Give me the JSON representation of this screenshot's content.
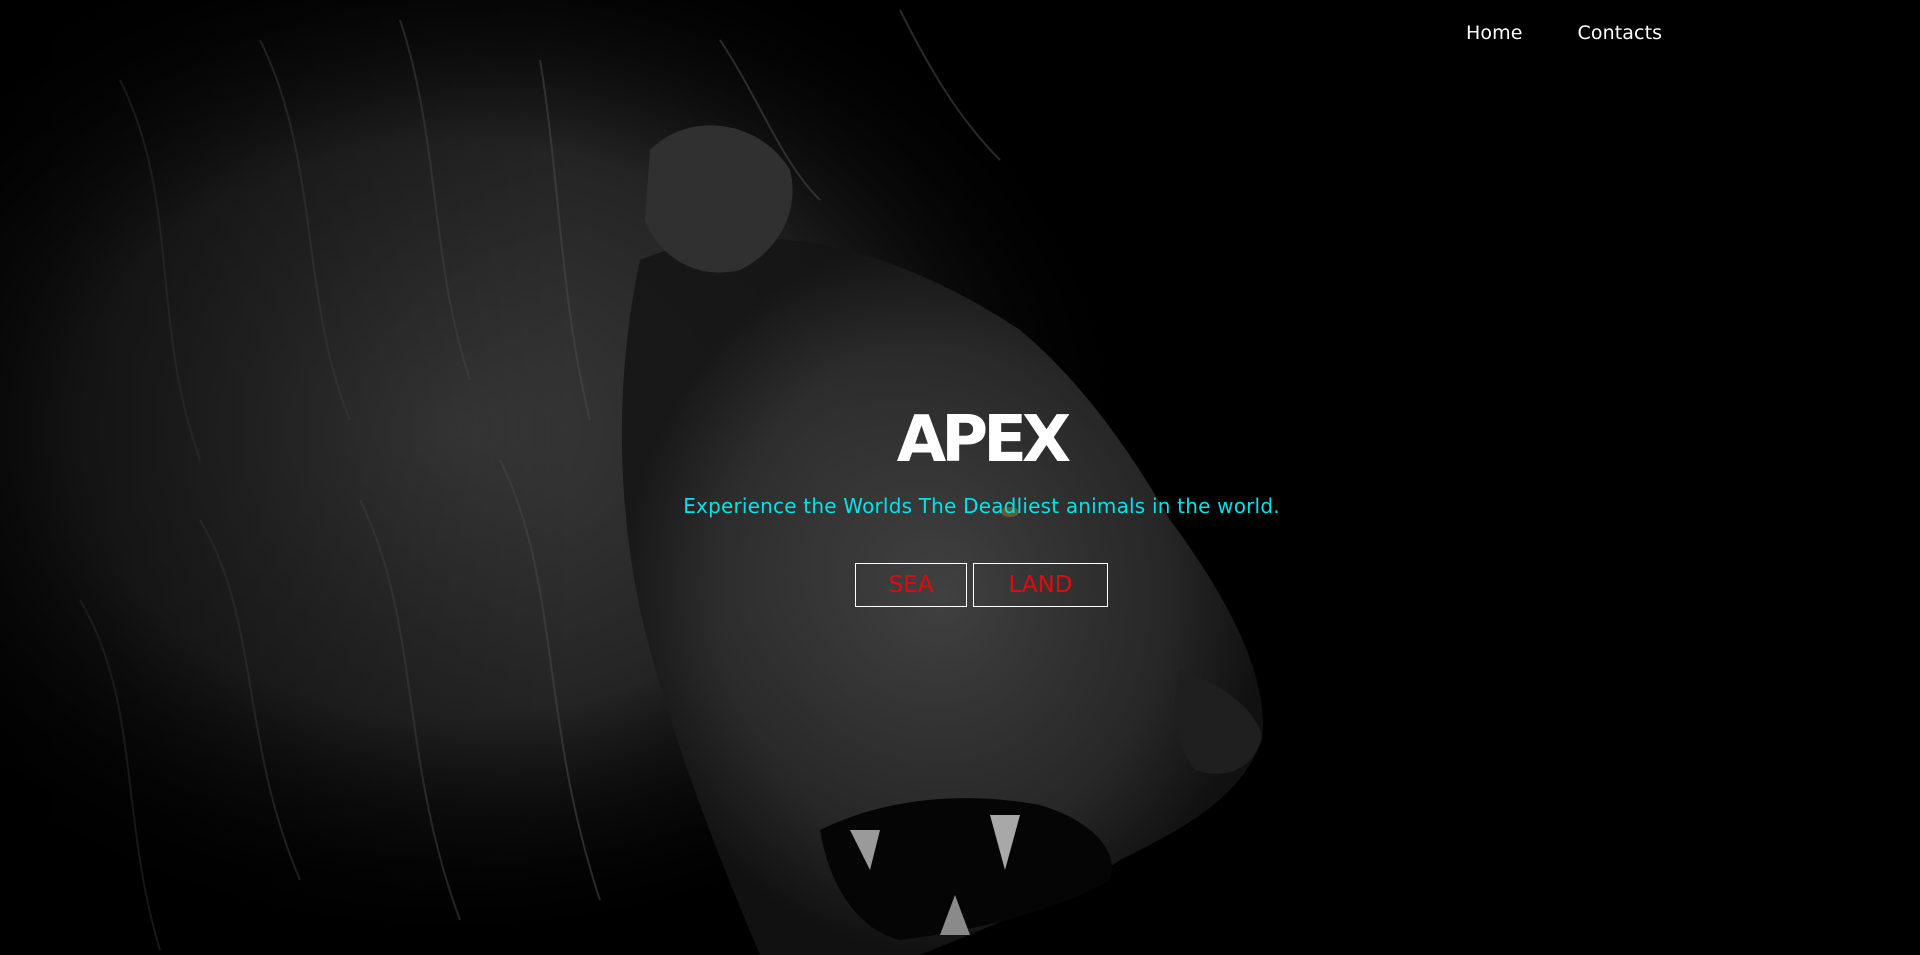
{
  "nav": {
    "items": [
      {
        "label": "Home"
      },
      {
        "label": "Contacts"
      }
    ]
  },
  "hero": {
    "title": "APEX",
    "subtitle": "Experience the Worlds The Deadliest animals in the world.",
    "buttons": [
      {
        "label": "SEA"
      },
      {
        "label": "LAND"
      }
    ]
  },
  "colors": {
    "background": "#000000",
    "title": "#ffffff",
    "subtitle": "#00e3ec",
    "button_text": "#e6090b",
    "button_border": "#ffffff"
  },
  "background_image": {
    "subject": "roaring-lion-grayscale"
  }
}
